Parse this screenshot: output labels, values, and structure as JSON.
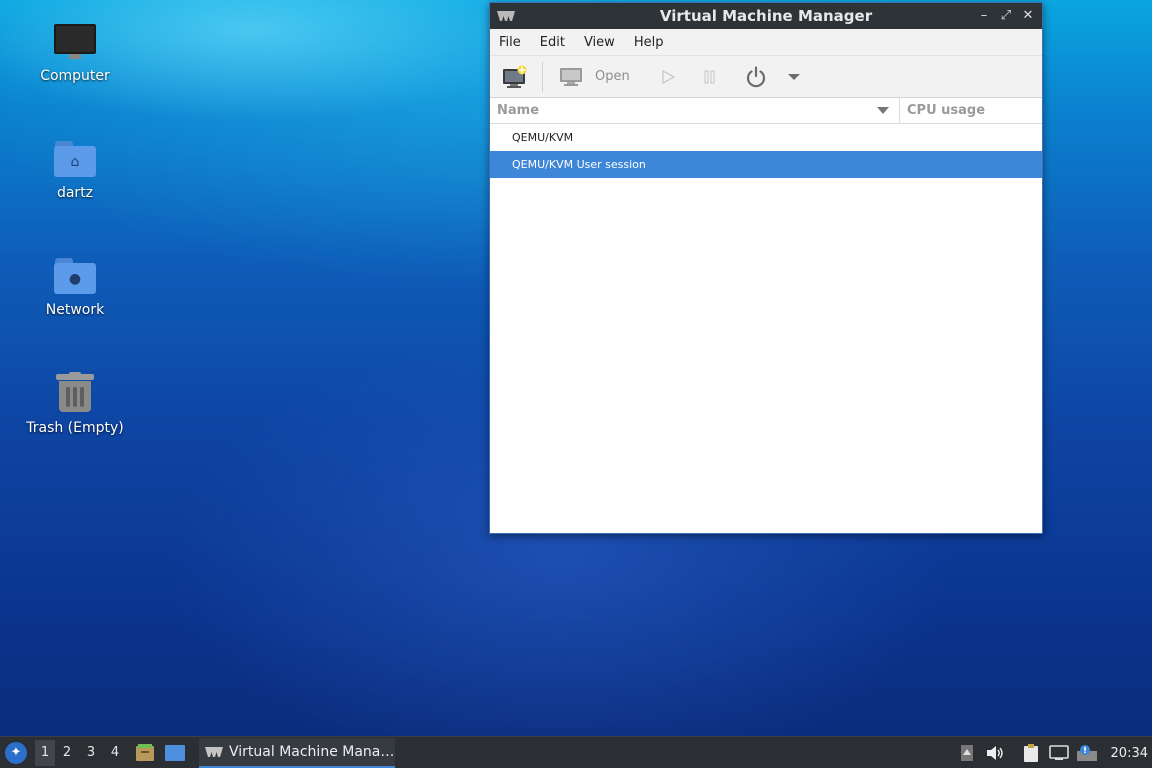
{
  "desktop": {
    "icons": [
      {
        "label": "Computer"
      },
      {
        "label": "dartz"
      },
      {
        "label": "Network"
      },
      {
        "label": "Trash (Empty)"
      }
    ]
  },
  "window": {
    "title": "Virtual Machine Manager",
    "controls": {
      "minimize": "–",
      "maximize": "⤢",
      "close": "✕"
    },
    "menu": [
      "File",
      "Edit",
      "View",
      "Help"
    ],
    "toolbar": {
      "open_label": "Open"
    },
    "columns": {
      "name": "Name",
      "cpu": "CPU usage"
    },
    "connections": [
      {
        "label": "QEMU/KVM",
        "selected": false
      },
      {
        "label": "QEMU/KVM User session",
        "selected": true
      }
    ]
  },
  "taskbar": {
    "workspaces": [
      "1",
      "2",
      "3",
      "4"
    ],
    "active_workspace": "1",
    "task_label": "Virtual Machine Mana…",
    "clock": "20:34"
  },
  "colors": {
    "selection": "#3d86d8",
    "titlebar": "#2e3338",
    "panel": "#2b2f33"
  }
}
